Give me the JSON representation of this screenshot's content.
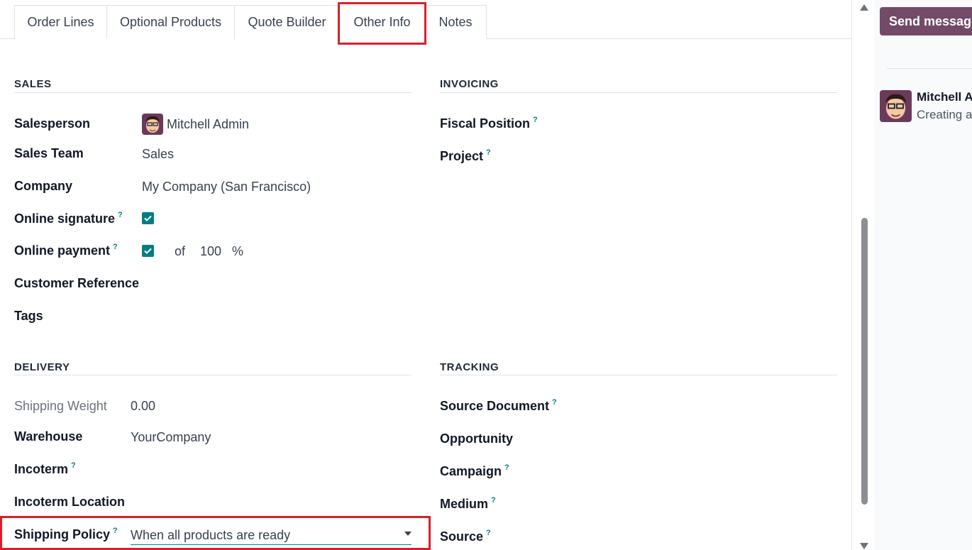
{
  "tabs": [
    {
      "label": "Order Lines"
    },
    {
      "label": "Optional Products"
    },
    {
      "label": "Quote Builder"
    },
    {
      "label": "Other Info"
    },
    {
      "label": "Notes"
    }
  ],
  "sales": {
    "title": "SALES",
    "salesperson_label": "Salesperson",
    "salesperson_value": "Mitchell Admin",
    "sales_team_label": "Sales Team",
    "sales_team_value": "Sales",
    "company_label": "Company",
    "company_value": "My Company (San Francisco)",
    "online_signature_label": "Online signature",
    "online_signature_checked": true,
    "online_payment_label": "Online payment",
    "online_payment_checked": true,
    "payment_of": "of",
    "payment_percent": "100",
    "percent_sign": "%",
    "customer_reference_label": "Customer Reference",
    "tags_label": "Tags"
  },
  "invoicing": {
    "title": "INVOICING",
    "fiscal_position_label": "Fiscal Position",
    "project_label": "Project"
  },
  "delivery": {
    "title": "DELIVERY",
    "shipping_weight_label": "Shipping Weight",
    "shipping_weight_value": "0.00",
    "warehouse_label": "Warehouse",
    "warehouse_value": "YourCompany",
    "incoterm_label": "Incoterm",
    "incoterm_location_label": "Incoterm Location",
    "shipping_policy_label": "Shipping Policy",
    "shipping_policy_value": "When all products are ready"
  },
  "tracking": {
    "title": "TRACKING",
    "source_document_label": "Source Document",
    "opportunity_label": "Opportunity",
    "campaign_label": "Campaign",
    "medium_label": "Medium",
    "source_label": "Source"
  },
  "help_mark": "?",
  "chatter": {
    "send_message_label": "Send message",
    "author": "Mitchell A",
    "message": "Creating a"
  },
  "colors": {
    "accent": "#017e84",
    "brand": "#714b67",
    "highlight": "#d9202a"
  }
}
